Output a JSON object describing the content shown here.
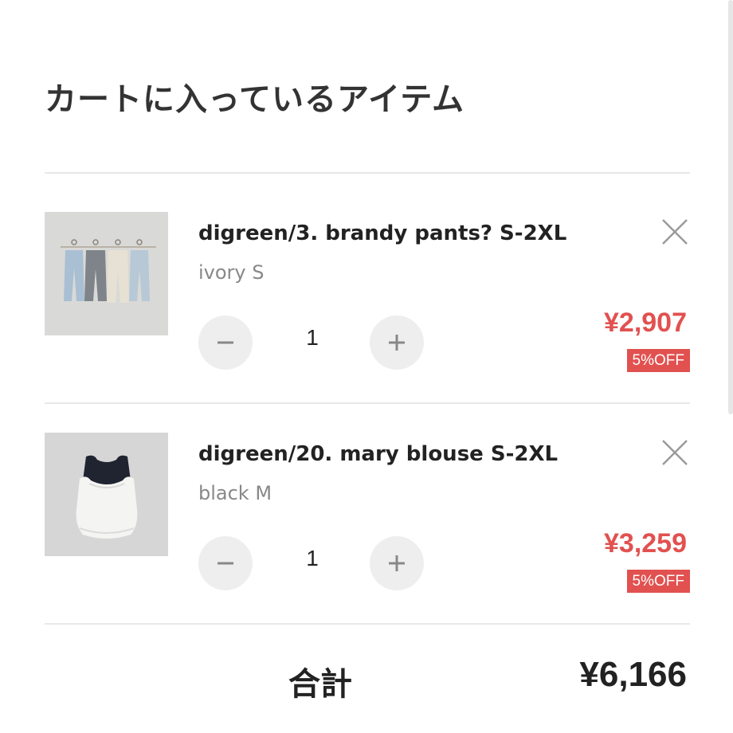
{
  "cart": {
    "title": "カートに入っているアイテム",
    "items": [
      {
        "name": "digreen/3. brandy pants? S-2XL",
        "variant": "ivory S",
        "quantity": "1",
        "price": "¥2,907",
        "discount": "5%OFF",
        "image": "product-pants-photo"
      },
      {
        "name": "digreen/20. mary blouse S-2XL",
        "variant": "black M",
        "quantity": "1",
        "price": "¥3,259",
        "discount": "5%OFF",
        "image": "product-blouse-photo"
      }
    ],
    "total_label": "合計",
    "total_value": "¥6,166"
  },
  "icons": {
    "remove": "close-icon",
    "decrease": "minus-icon",
    "increase": "plus-icon"
  },
  "colors": {
    "price": "#e15150",
    "badge_bg": "#e15150",
    "qty_button_bg": "#eeeeee",
    "divider": "#e8e8e8"
  }
}
